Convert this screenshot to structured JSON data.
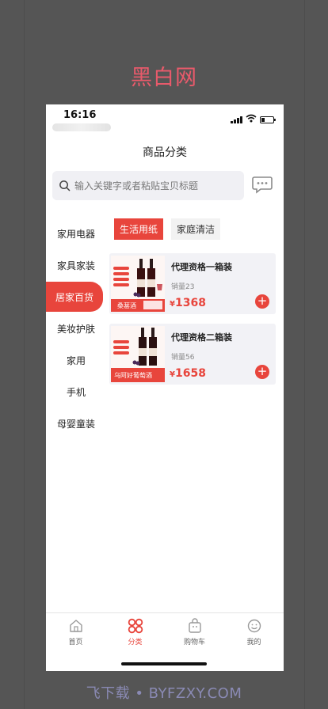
{
  "brand": "黑白网",
  "status_bar": {
    "time": "16:16"
  },
  "page_title": "商品分类",
  "search": {
    "placeholder": "输入关键字或者粘贴宝贝标题"
  },
  "sidebar": {
    "items": [
      {
        "label": "家用电器",
        "active": false
      },
      {
        "label": "家具家装",
        "active": false
      },
      {
        "label": "居家百货",
        "active": true
      },
      {
        "label": "美妆护肤",
        "active": false
      },
      {
        "label": "家用",
        "active": false
      },
      {
        "label": "手机",
        "active": false
      },
      {
        "label": "母婴童装",
        "active": false
      }
    ]
  },
  "subtabs": [
    {
      "label": "生活用纸",
      "active": true
    },
    {
      "label": "家庭清洁",
      "active": false
    }
  ],
  "products": [
    {
      "name": "代理资格一箱装",
      "sales": "销量23",
      "currency": "¥",
      "price": "1368",
      "banner_text": "桑葚酒"
    },
    {
      "name": "代理资格二箱装",
      "sales": "销量56",
      "currency": "¥",
      "price": "1658",
      "banner_text": "乌阿好葡萄酒"
    }
  ],
  "tabbar": [
    {
      "label": "首页",
      "icon": "home-icon",
      "active": false
    },
    {
      "label": "分类",
      "icon": "category-icon",
      "active": true
    },
    {
      "label": "购物车",
      "icon": "cart-icon",
      "active": false
    },
    {
      "label": "我的",
      "icon": "profile-icon",
      "active": false
    }
  ],
  "watermark": "飞下载 • BYFZXY.COM",
  "colors": {
    "accent": "#e8453c",
    "brand": "#e85a6b",
    "backdrop": "#555555"
  }
}
